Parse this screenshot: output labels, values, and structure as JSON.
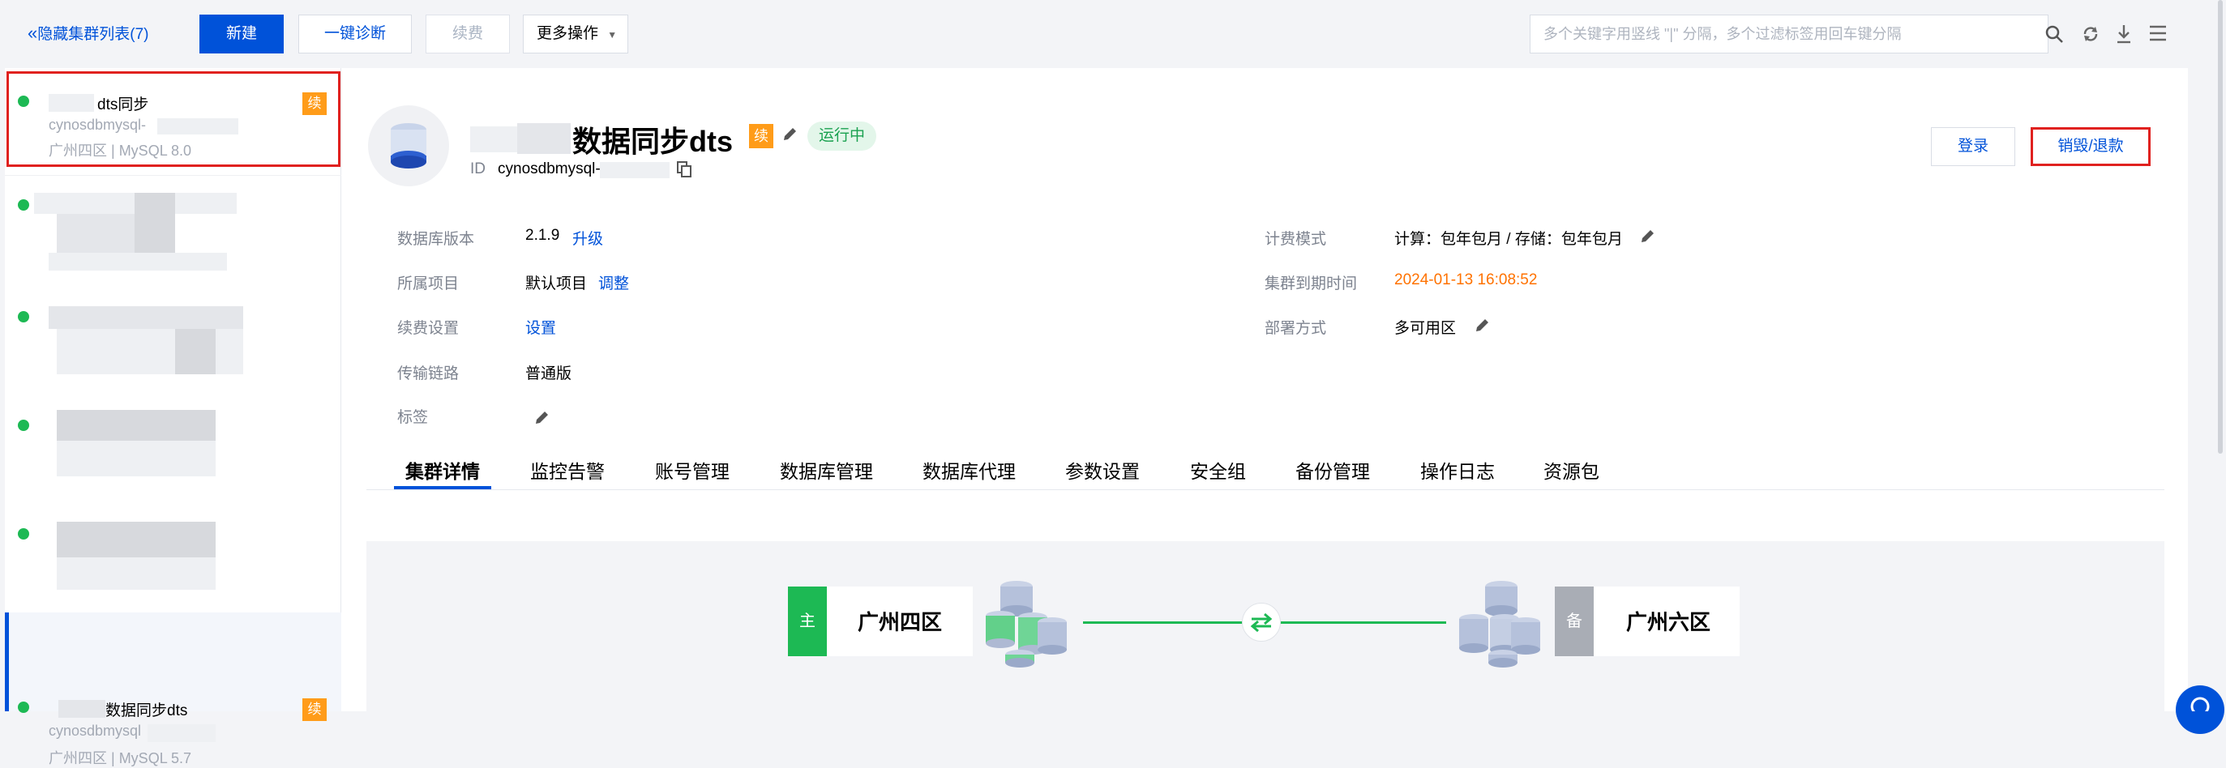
{
  "toolbar": {
    "hide_list_label": "隐藏集群列表(7)",
    "new_label": "新建",
    "diagnose_label": "一键诊断",
    "renew_label": "续费",
    "more_label": "更多操作",
    "search_placeholder": "多个关键字用竖线 \"|\" 分隔，多个过滤标签用回车键分隔"
  },
  "sidebar": {
    "clusters": [
      {
        "name": "dts同步",
        "id": "cynosdbmysql-",
        "region": "广州四区",
        "version": "MySQL 8.0",
        "renew": "续",
        "status_color": "#1db954"
      },
      {
        "status_color": "#1db954"
      },
      {
        "status_color": "#1db954"
      },
      {
        "status_color": "#1db954"
      },
      {
        "status_color": "#1db954"
      },
      {
        "name": "数据同步dts",
        "id": "cynosdbmysql",
        "region": "广州四区",
        "version": "MySQL 5.7",
        "renew": "续",
        "status_color": "#1db954",
        "selected": true
      }
    ]
  },
  "header": {
    "title": "数据同步dts",
    "renew_badge": "续",
    "status": "运行中",
    "id_label": "ID",
    "id_value": "cynosdbmysql-",
    "login_label": "登录",
    "destroy_label": "销毁/退款"
  },
  "info": {
    "db_version_label": "数据库版本",
    "db_version_value": "2.1.9",
    "upgrade_link": "升级",
    "project_label": "所属项目",
    "project_value": "默认项目",
    "project_adjust": "调整",
    "renew_setting_label": "续费设置",
    "renew_setting_link": "设置",
    "link_label": "传输链路",
    "link_value": "普通版",
    "tag_label": "标签",
    "billing_label": "计费模式",
    "billing_value": "计算：包年包月 / 存储：包年包月",
    "expire_label": "集群到期时间",
    "expire_value": "2024-01-13 16:08:52",
    "deploy_label": "部署方式",
    "deploy_value": "多可用区"
  },
  "tabs": [
    "集群详情",
    "监控告警",
    "账号管理",
    "数据库管理",
    "数据库代理",
    "参数设置",
    "安全组",
    "备份管理",
    "操作日志",
    "资源包"
  ],
  "topology": {
    "primary_tag": "主",
    "primary_region": "广州四区",
    "standby_tag": "备",
    "standby_region": "广州六区",
    "primary_color": "#1db954",
    "standby_color": "#a9adb5"
  },
  "colors": {
    "brand_blue": "#0052d9",
    "status_green": "#1db954",
    "renew_orange": "#ff9c19",
    "highlight_red": "#e0211f"
  }
}
